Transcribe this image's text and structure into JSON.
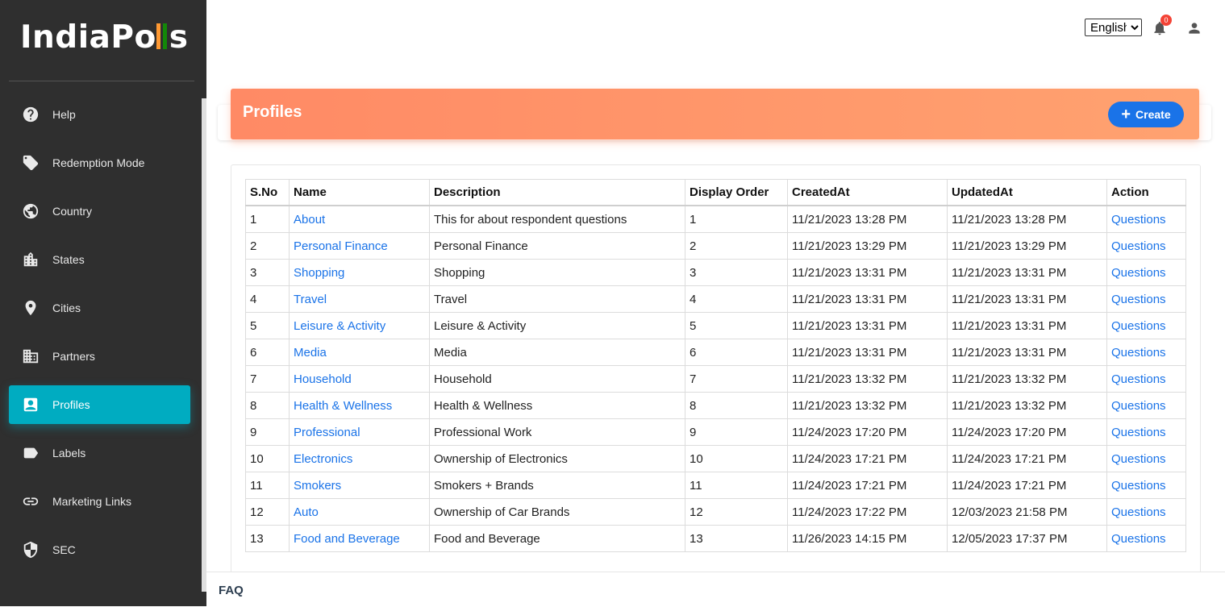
{
  "logo": {
    "text_a": "IndiaPo",
    "text_b": "s",
    "bar_colors": [
      "#ff9933",
      "#138808"
    ]
  },
  "sidebar": {
    "items": [
      {
        "label": "Help",
        "icon": "help-icon"
      },
      {
        "label": "Redemption Mode",
        "icon": "tag-icon"
      },
      {
        "label": "Country",
        "icon": "globe-icon"
      },
      {
        "label": "States",
        "icon": "buildings-icon"
      },
      {
        "label": "Cities",
        "icon": "location-pin-icon"
      },
      {
        "label": "Partners",
        "icon": "business-icon"
      },
      {
        "label": "Profiles",
        "icon": "contact-card-icon",
        "active": true
      },
      {
        "label": "Labels",
        "icon": "label-icon"
      },
      {
        "label": "Marketing Links",
        "icon": "link-icon"
      },
      {
        "label": "SEC",
        "icon": "shield-icon"
      }
    ]
  },
  "topbar": {
    "language": "English",
    "notification_count": "0",
    "bell_icon": "bell-icon",
    "user_icon": "person-icon"
  },
  "header": {
    "title": "Profiles",
    "create_label": "Create",
    "color": "#ff8a65"
  },
  "table": {
    "columns": [
      "S.No",
      "Name",
      "Description",
      "Display Order",
      "CreatedAt",
      "UpdatedAt",
      "Action"
    ],
    "rows": [
      {
        "sno": "1",
        "name": "About",
        "description": "This for about respondent questions",
        "order": "1",
        "created": "11/21/2023 13:28 PM",
        "updated": "11/21/2023 13:28 PM",
        "action": "Questions"
      },
      {
        "sno": "2",
        "name": "Personal Finance",
        "description": "Personal Finance",
        "order": "2",
        "created": "11/21/2023 13:29 PM",
        "updated": "11/21/2023 13:29 PM",
        "action": "Questions"
      },
      {
        "sno": "3",
        "name": "Shopping",
        "description": "Shopping",
        "order": "3",
        "created": "11/21/2023 13:31 PM",
        "updated": "11/21/2023 13:31 PM",
        "action": "Questions"
      },
      {
        "sno": "4",
        "name": "Travel",
        "description": "Travel",
        "order": "4",
        "created": "11/21/2023 13:31 PM",
        "updated": "11/21/2023 13:31 PM",
        "action": "Questions"
      },
      {
        "sno": "5",
        "name": "Leisure & Activity",
        "description": "Leisure & Activity",
        "order": "5",
        "created": "11/21/2023 13:31 PM",
        "updated": "11/21/2023 13:31 PM",
        "action": "Questions"
      },
      {
        "sno": "6",
        "name": "Media",
        "description": "Media",
        "order": "6",
        "created": "11/21/2023 13:31 PM",
        "updated": "11/21/2023 13:31 PM",
        "action": "Questions"
      },
      {
        "sno": "7",
        "name": "Household",
        "description": "Household",
        "order": "7",
        "created": "11/21/2023 13:32 PM",
        "updated": "11/21/2023 13:32 PM",
        "action": "Questions"
      },
      {
        "sno": "8",
        "name": "Health & Wellness",
        "description": "Health & Wellness",
        "order": "8",
        "created": "11/21/2023 13:32 PM",
        "updated": "11/21/2023 13:32 PM",
        "action": "Questions"
      },
      {
        "sno": "9",
        "name": "Professional",
        "description": "Professional Work",
        "order": "9",
        "created": "11/24/2023 17:20 PM",
        "updated": "11/24/2023 17:20 PM",
        "action": "Questions"
      },
      {
        "sno": "10",
        "name": "Electronics",
        "description": "Ownership of Electronics",
        "order": "10",
        "created": "11/24/2023 17:21 PM",
        "updated": "11/24/2023 17:21 PM",
        "action": "Questions"
      },
      {
        "sno": "11",
        "name": "Smokers",
        "description": "Smokers + Brands",
        "order": "11",
        "created": "11/24/2023 17:21 PM",
        "updated": "11/24/2023 17:21 PM",
        "action": "Questions"
      },
      {
        "sno": "12",
        "name": "Auto",
        "description": "Ownership of Car Brands",
        "order": "12",
        "created": "11/24/2023 17:22 PM",
        "updated": "12/03/2023 21:58 PM",
        "action": "Questions"
      },
      {
        "sno": "13",
        "name": "Food and Beverage",
        "description": "Food and Beverage",
        "order": "13",
        "created": "11/26/2023 14:15 PM",
        "updated": "12/05/2023 17:37 PM",
        "action": "Questions"
      }
    ]
  },
  "footer": {
    "faq": "FAQ"
  }
}
